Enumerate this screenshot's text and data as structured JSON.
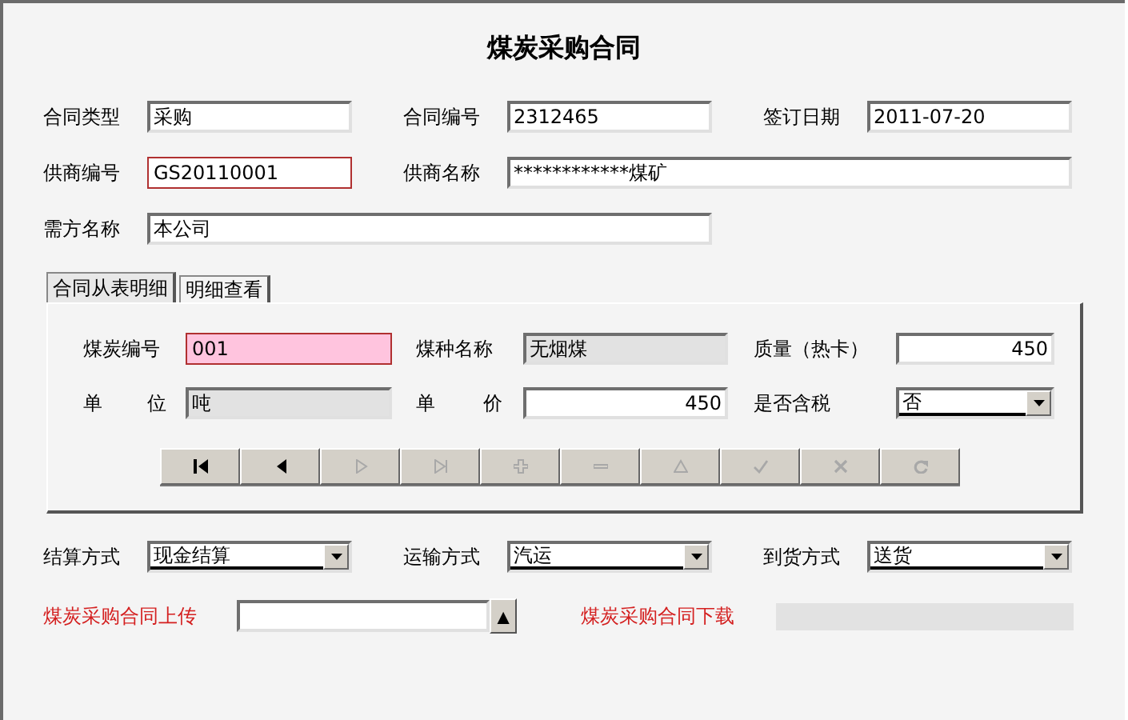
{
  "title": "煤炭采购合同",
  "header_rows": [
    [
      {
        "label": "合同类型",
        "value": "采购",
        "highlighted": false
      },
      {
        "label": "合同编号",
        "value": "2312465",
        "highlighted": false
      },
      {
        "label": "签订日期",
        "value": "2011-07-20",
        "highlighted": false
      }
    ],
    [
      {
        "label": "供商编号",
        "value": "GS20110001",
        "highlighted": true
      },
      {
        "label": "供商名称",
        "value": "************煤矿",
        "highlighted": false
      }
    ],
    [
      {
        "label": "需方名称",
        "value": "本公司",
        "highlighted": false
      }
    ]
  ],
  "tabs": [
    {
      "label": "合同从表明细",
      "selected": true
    },
    {
      "label": "明细查看",
      "selected": false
    }
  ],
  "detail_rows": [
    [
      {
        "kind": "text",
        "label": "煤炭编号",
        "value": "001",
        "highlighted": true,
        "readonly": false
      },
      {
        "kind": "text",
        "label": "煤种名称",
        "value": "无烟煤",
        "highlighted": false,
        "readonly": true
      },
      {
        "kind": "number",
        "label": "质量（热卡）",
        "value": "450",
        "highlighted": false,
        "readonly": false
      }
    ],
    [
      {
        "kind": "text",
        "label": "单位",
        "value": "吨",
        "highlighted": false,
        "readonly": true
      },
      {
        "kind": "number",
        "label": "单价",
        "value": "450",
        "highlighted": false,
        "readonly": false
      },
      {
        "kind": "combo",
        "label": "是否含税",
        "value": "否"
      }
    ]
  ],
  "nav_buttons": [
    {
      "kind": "first",
      "disabled": false
    },
    {
      "kind": "prev",
      "disabled": false
    },
    {
      "kind": "next",
      "disabled": true
    },
    {
      "kind": "last",
      "disabled": true
    },
    {
      "kind": "add",
      "disabled": true
    },
    {
      "kind": "delete",
      "disabled": true
    },
    {
      "kind": "edit",
      "disabled": true
    },
    {
      "kind": "save",
      "disabled": true
    },
    {
      "kind": "cancel",
      "disabled": true
    },
    {
      "kind": "refresh",
      "disabled": true
    }
  ],
  "options": [
    {
      "label": "结算方式",
      "value": "现金结算"
    },
    {
      "label": "运输方式",
      "value": "汽运"
    },
    {
      "label": "到货方式",
      "value": "送货"
    }
  ],
  "upload": {
    "label": "煤炭采购合同上传",
    "button": "▲"
  },
  "download": {
    "label": "煤炭采购合同下载"
  }
}
